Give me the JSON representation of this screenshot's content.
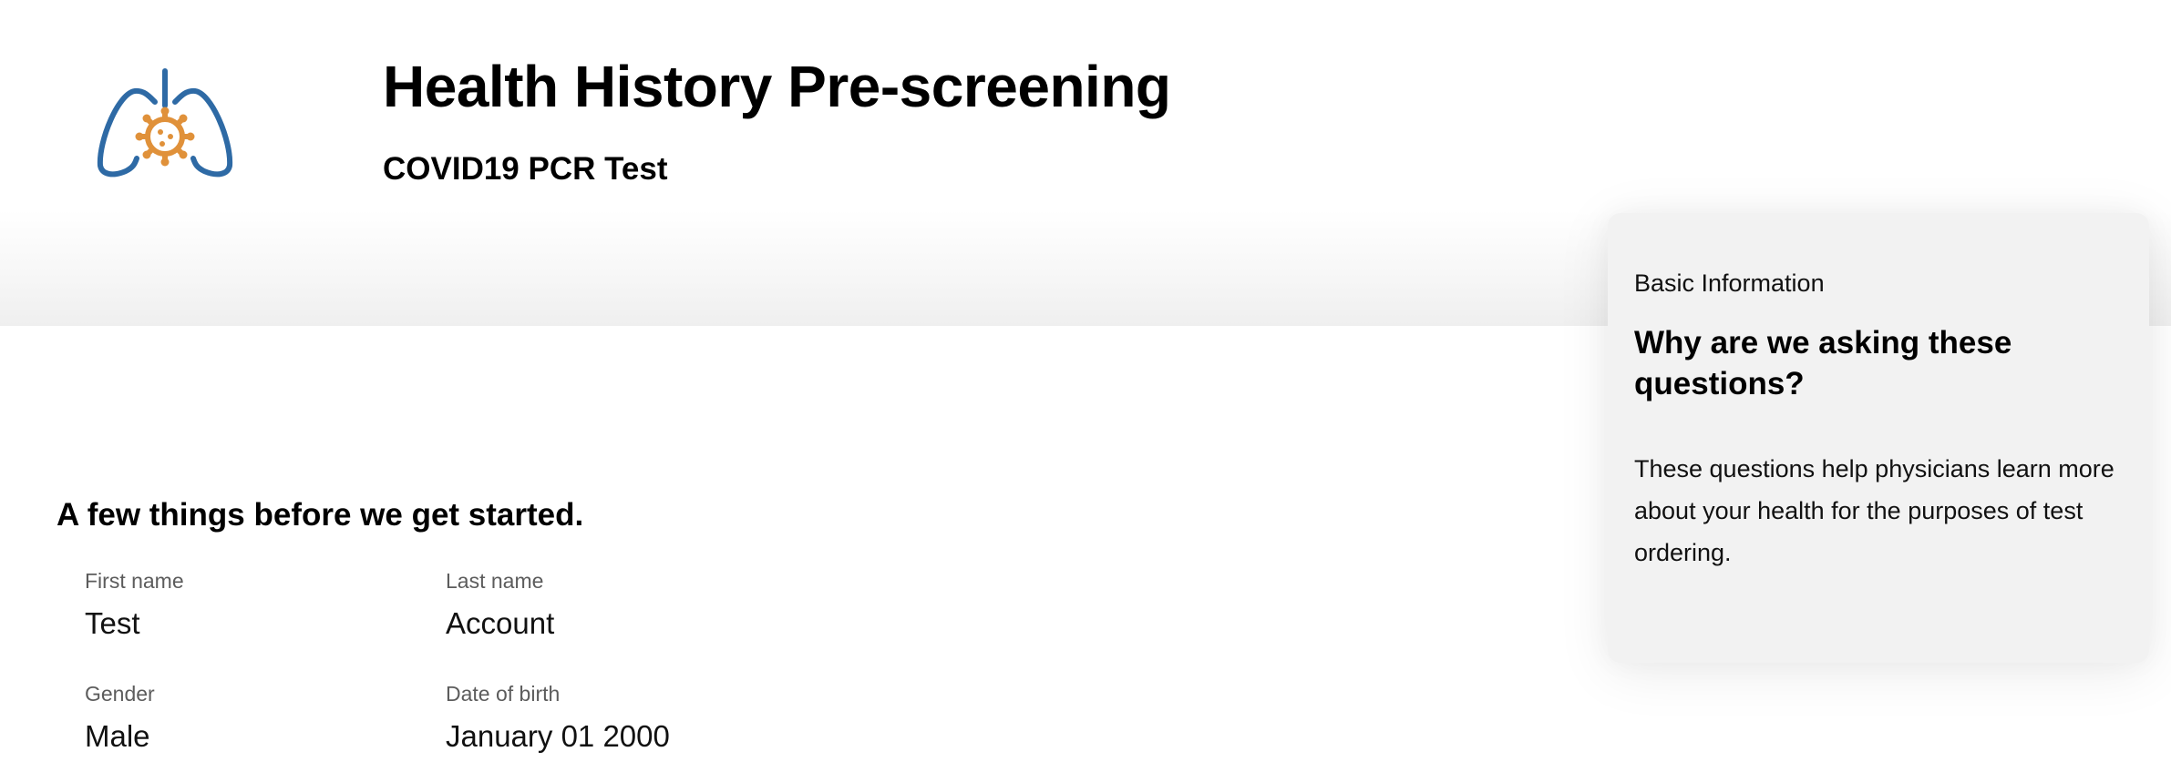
{
  "header": {
    "title": "Health History Pre-screening",
    "subtitle": "COVID19 PCR Test",
    "logo_icon": "lungs-virus-icon",
    "colors": {
      "logo_primary": "#2e6aa5",
      "logo_accent": "#e0913a"
    }
  },
  "form": {
    "intro": "A few things before we get started.",
    "fields": [
      {
        "label": "First name",
        "value": "Test"
      },
      {
        "label": "Last name",
        "value": "Account"
      },
      {
        "label": "Gender",
        "value": "Male"
      },
      {
        "label": "Date of birth",
        "value": "January 01 2000"
      }
    ]
  },
  "info_card": {
    "section": "Basic Information",
    "question": "Why are we asking these questions?",
    "body": "These questions help physicians learn more about your health for the purposes of test ordering."
  }
}
